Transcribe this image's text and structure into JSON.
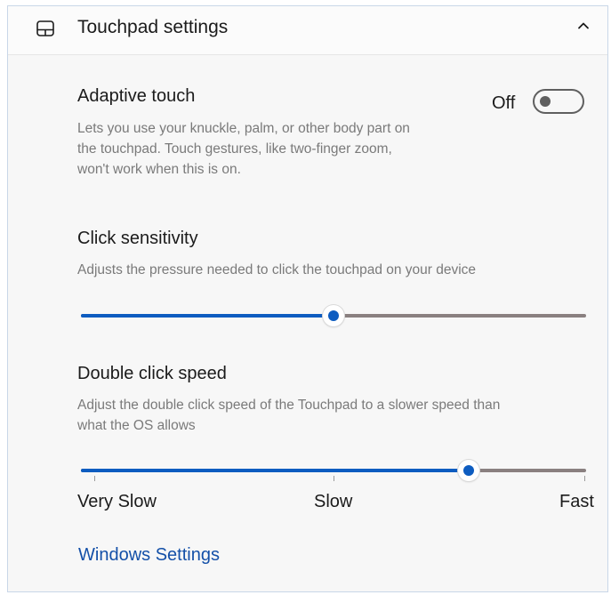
{
  "header": {
    "title": "Touchpad settings",
    "icon": "touchpad-icon",
    "collapse_icon": "chevron-up-icon"
  },
  "adaptive_touch": {
    "title": "Adaptive touch",
    "description_lines": [
      "Lets you use your knuckle, palm, or other body part on",
      "the touchpad. Touch gestures, like two-finger zoom,",
      "won't work when this is on."
    ],
    "toggle_state": "Off",
    "toggle_on": false
  },
  "click_sensitivity": {
    "title": "Click sensitivity",
    "description": "Adjusts the pressure needed to click the touchpad on your device",
    "value_fraction": 0.5
  },
  "double_click_speed": {
    "title": "Double click speed",
    "description_lines": [
      "Adjust the double click speed of the Touchpad to a slower speed than",
      "what the OS allows"
    ],
    "value_fraction": 0.767,
    "tick_labels": [
      "Very Slow",
      "Slow",
      "Fast"
    ]
  },
  "windows_settings_link": "Windows Settings",
  "colors": {
    "accent": "#0d5cc0",
    "link": "#1450a8",
    "track_inactive": "#8a8080",
    "description_text": "#7a7a7a"
  }
}
